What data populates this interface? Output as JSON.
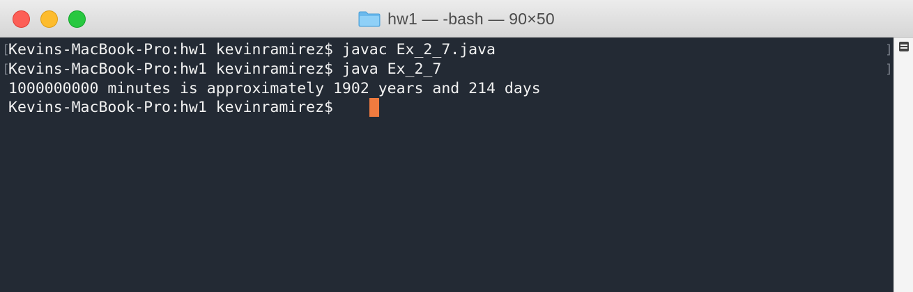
{
  "window": {
    "title": "hw1 — -bash — 90×50",
    "folder_icon": "folder-icon",
    "accent_colors": {
      "close": "#fc5f57",
      "minimize": "#fdbc2e",
      "zoom": "#28c840",
      "cursor": "#f07b3f",
      "background": "#232a34",
      "text": "#f1f1f1"
    }
  },
  "terminal": {
    "lines": [
      "Kevins-MacBook-Pro:hw1 kevinramirez$ javac Ex_2_7.java",
      "Kevins-MacBook-Pro:hw1 kevinramirez$ java Ex_2_7",
      "1000000000 minutes is approximately 1902 years and 214 days",
      "Kevins-MacBook-Pro:hw1 kevinramirez$ "
    ],
    "marks": {
      "line1_left": "[",
      "line1_right": "]",
      "line2_left": "[",
      "line2_right": "]"
    }
  }
}
